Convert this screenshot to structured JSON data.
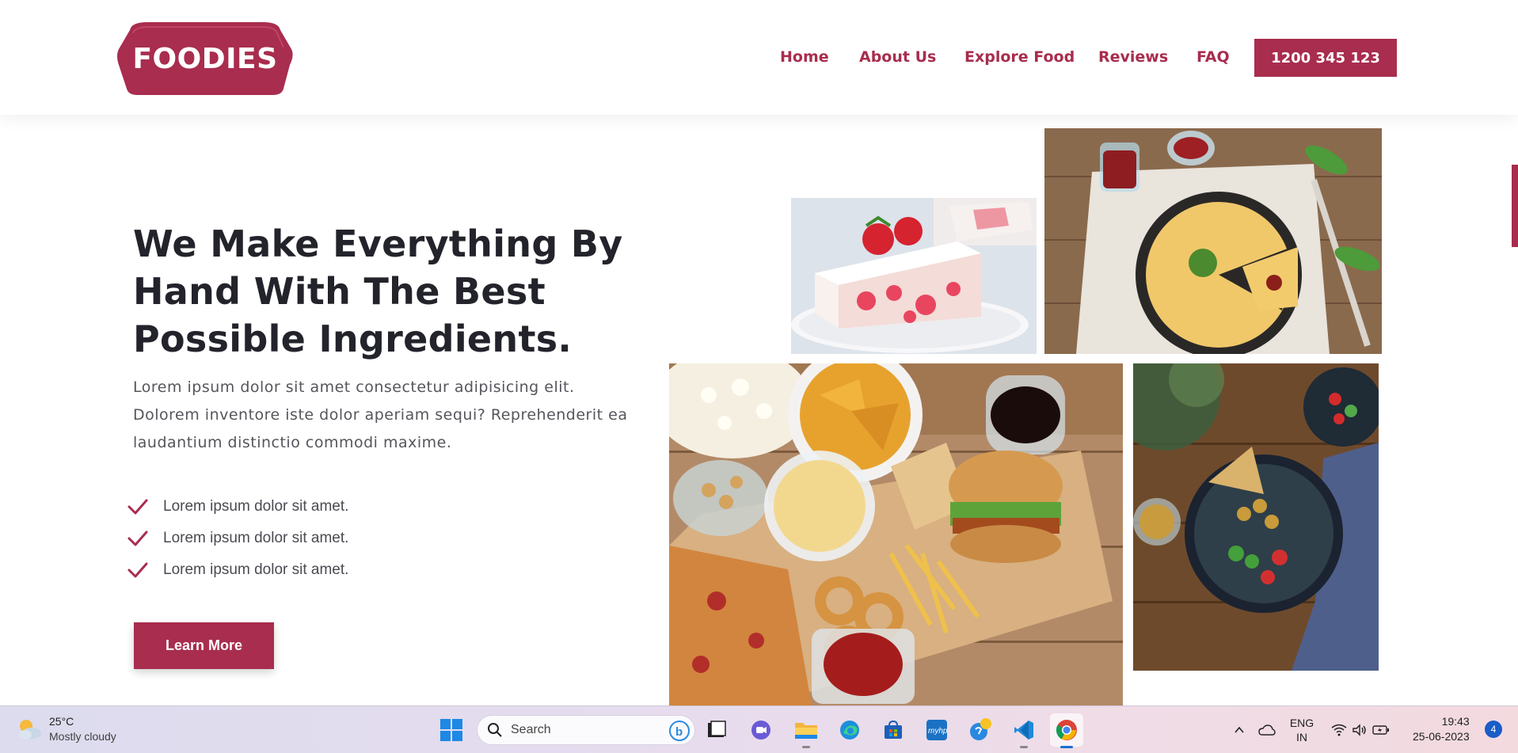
{
  "brand": {
    "logo_text": "FOODIES",
    "accent": "#a82d4e"
  },
  "nav": {
    "items": [
      {
        "label": "Home"
      },
      {
        "label": "About Us"
      },
      {
        "label": "Explore Food"
      },
      {
        "label": "Reviews"
      },
      {
        "label": "FAQ"
      }
    ],
    "phone": "1200 345 123"
  },
  "hero": {
    "title_lines": [
      "We Make Everything By",
      "Hand With The Best",
      "Possible Ingredients."
    ],
    "description_lines": [
      "Lorem ipsum dolor sit amet consectetur adipisicing elit.",
      "Dolorem inventore iste dolor aperiam sequi? Reprehenderit ea",
      "laudantium distinctio commodi maxime."
    ],
    "features": [
      "Lorem ipsum dolor sit amet.",
      "Lorem ipsum dolor sit amet.",
      "Lorem ipsum dolor sit amet."
    ],
    "cta": "Learn More"
  },
  "gallery": {
    "images": [
      {
        "name": "strawberry-cake-photo"
      },
      {
        "name": "omelette-photo"
      },
      {
        "name": "fast-food-platter-photo"
      },
      {
        "name": "salad-bowl-photo"
      }
    ]
  },
  "taskbar": {
    "weather_temp": "25°C",
    "weather_condition": "Mostly cloudy",
    "search_placeholder": "Search",
    "apps": [
      "file-explorer-terminal",
      "teams-chat",
      "file-explorer",
      "edge",
      "microsoft-store",
      "myhp",
      "get-started",
      "vscode",
      "chrome"
    ],
    "language_line1": "ENG",
    "language_line2": "IN",
    "time": "19:43",
    "date": "25-06-2023",
    "notification_count": "4"
  }
}
